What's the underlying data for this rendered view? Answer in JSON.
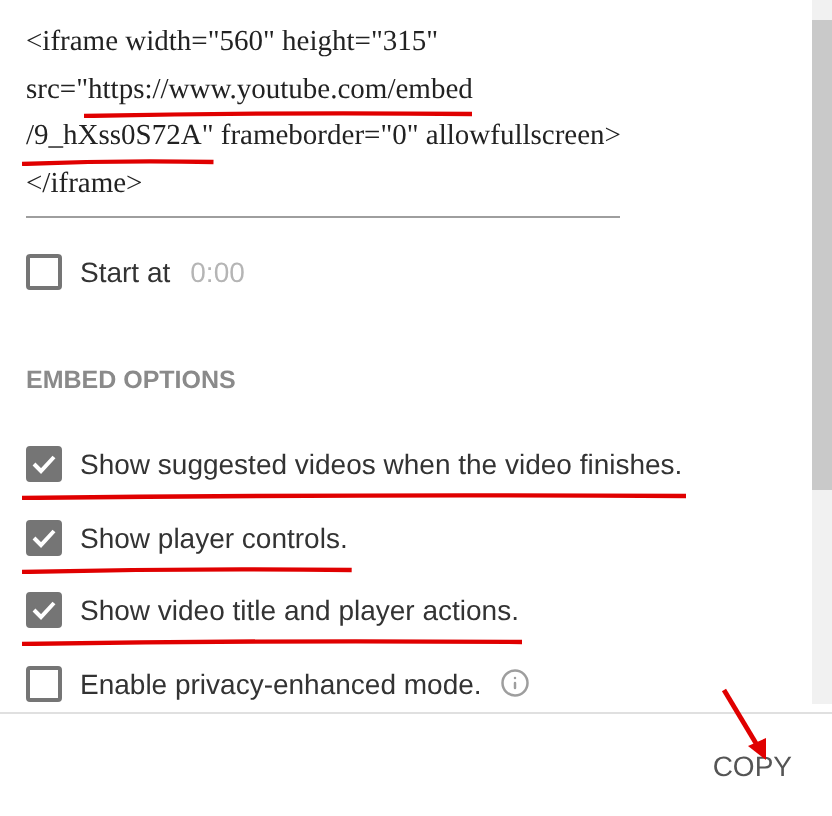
{
  "embed_code": [
    {
      "segments": [
        {
          "text": "<iframe width=\"560\" height=\"315\"",
          "underlined": false
        }
      ]
    },
    {
      "segments": [
        {
          "text": "src=\"",
          "underlined": false
        },
        {
          "text": "https://www.youtube.com/embed",
          "underlined": true
        }
      ]
    },
    {
      "segments": [
        {
          "text": "/9_hXss0S72A\"",
          "underlined": true
        },
        {
          "text": " frameborder=\"0\" allowfullscreen>",
          "underlined": false
        }
      ]
    },
    {
      "segments": [
        {
          "text": "</iframe>",
          "underlined": false
        }
      ]
    }
  ],
  "start_at": {
    "label": "Start at",
    "checked": false,
    "value": "0:00"
  },
  "section_title": "EMBED OPTIONS",
  "options": [
    {
      "label": "Show suggested videos when the video finishes.",
      "checked": true,
      "underlined": true,
      "info": false
    },
    {
      "label": "Show player controls.",
      "checked": true,
      "underlined": true,
      "info": false
    },
    {
      "label": "Show video title and player actions.",
      "checked": true,
      "underlined": true,
      "info": false
    },
    {
      "label": "Enable privacy-enhanced mode.",
      "checked": false,
      "underlined": false,
      "info": true
    }
  ],
  "copy_button": {
    "label": "COPY",
    "arrow": true
  }
}
